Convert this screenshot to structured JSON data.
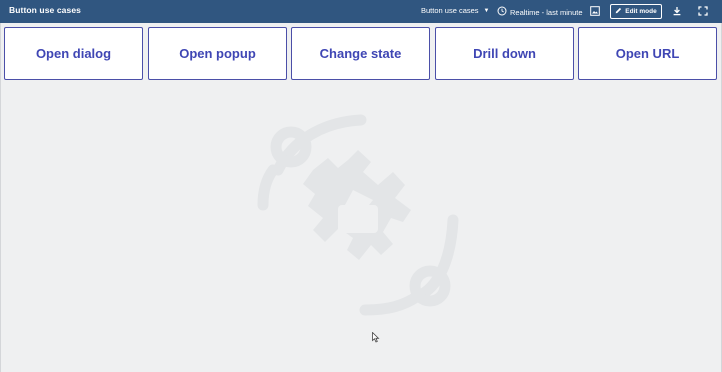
{
  "header": {
    "title": "Button use cases",
    "dashboard_selector": "Button use cases",
    "time_range": "Realtime - last minute",
    "edit_mode_label": "Edit mode"
  },
  "buttons": [
    {
      "label": "Open dialog"
    },
    {
      "label": "Open popup"
    },
    {
      "label": "Change state"
    },
    {
      "label": "Drill down"
    },
    {
      "label": "Open URL"
    }
  ],
  "icons": {
    "clock": "clock-icon",
    "image": "image-icon",
    "pencil": "pencil-icon",
    "download": "download-icon",
    "fullscreen": "fullscreen-icon"
  },
  "colors": {
    "header_bg": "#305680",
    "button_text": "#3f46b4",
    "button_border": "#4b4fa8",
    "canvas_bg": "#eff0f1"
  }
}
